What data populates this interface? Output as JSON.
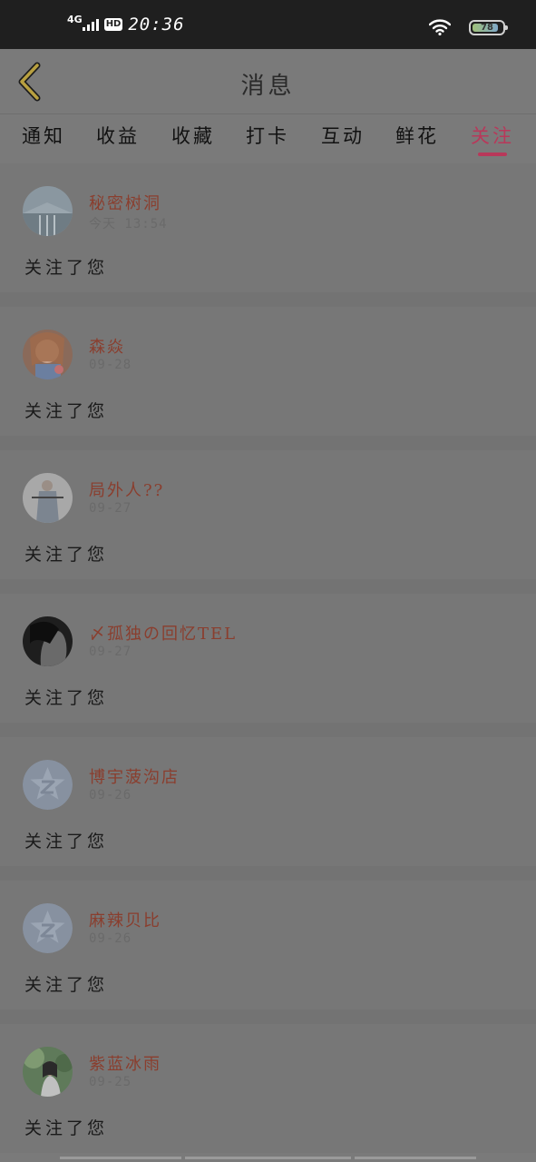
{
  "status_bar": {
    "network": "4G",
    "hd": "HD",
    "time": "20:36",
    "battery": "78",
    "icons": [
      "signal-icon",
      "wifi-icon",
      "battery-icon"
    ]
  },
  "header": {
    "title": "消息",
    "back_icon": "chevron-left-icon",
    "accent": "#b8385a"
  },
  "tabs": [
    {
      "label": "通知",
      "active": false
    },
    {
      "label": "收益",
      "active": false
    },
    {
      "label": "收藏",
      "active": false
    },
    {
      "label": "打卡",
      "active": false
    },
    {
      "label": "互动",
      "active": false
    },
    {
      "label": "鲜花",
      "active": false
    },
    {
      "label": "关注",
      "active": true
    }
  ],
  "notifications": [
    {
      "name": "秘密树洞",
      "time": "今天 13:54",
      "message": "关注了您",
      "avatar": "avatar-photo"
    },
    {
      "name": "森焱",
      "time": "09-28",
      "message": "关注了您",
      "avatar": "avatar-illustration"
    },
    {
      "name": "局外人??",
      "time": "09-27",
      "message": "关注了您",
      "avatar": "avatar-photo"
    },
    {
      "name": "〆孤独の回忆TEL",
      "time": "09-27",
      "message": "关注了您",
      "avatar": "avatar-photo"
    },
    {
      "name": "博宇菠沟店",
      "time": "09-26",
      "message": "关注了您",
      "avatar": "default-avatar-icon"
    },
    {
      "name": "麻辣贝比",
      "time": "09-26",
      "message": "关注了您",
      "avatar": "default-avatar-icon"
    },
    {
      "name": "紫蓝冰雨",
      "time": "09-25",
      "message": "关注了您",
      "avatar": "avatar-photo"
    }
  ]
}
